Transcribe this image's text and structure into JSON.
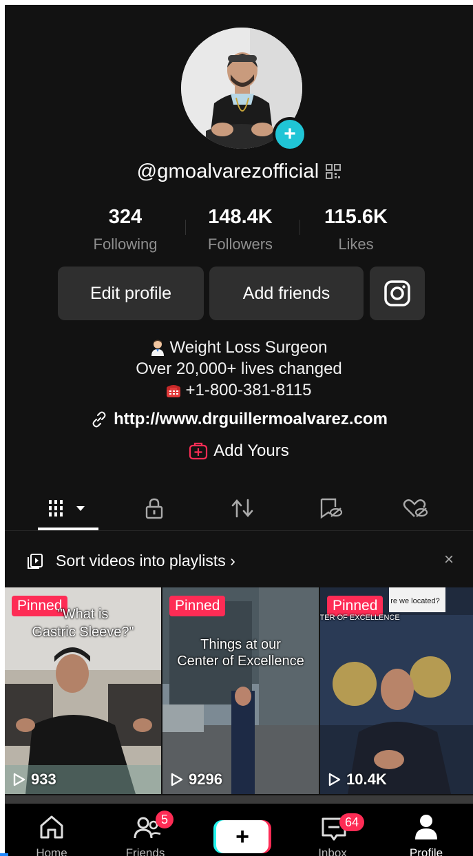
{
  "profile": {
    "username": "@gmoalvarezofficial",
    "stats": [
      {
        "value": "324",
        "label": "Following"
      },
      {
        "value": "148.4K",
        "label": "Followers"
      },
      {
        "value": "115.6K",
        "label": "Likes"
      }
    ]
  },
  "actions": {
    "edit_profile": "Edit profile",
    "add_friends": "Add friends",
    "instagram_icon": "instagram-icon"
  },
  "bio": {
    "line1": "Weight Loss Surgeon",
    "line2": "Over 20,000+ lives changed",
    "line3": "+1-800-381-8115",
    "link": "http://www.drguillermoalvarez.com",
    "add_yours": "Add Yours"
  },
  "tabs": [
    "videos-grid-icon",
    "lock-icon",
    "repost-icon",
    "saved-icon",
    "liked-icon"
  ],
  "playlists_banner": {
    "text": "Sort videos into playlists ›",
    "close": "×"
  },
  "videos": [
    {
      "pinned": "Pinned",
      "caption_line1": "\"What is",
      "caption_line2": "Gastric Sleeve?\"",
      "views": "933"
    },
    {
      "pinned": "Pinned",
      "caption_line1": "Things at our",
      "caption_line2": "Center of Excellence",
      "views": "9296"
    },
    {
      "pinned": "Pinned",
      "caption_line1": "re we located?",
      "caption_line2": "CENTER OF EXCELLENCE",
      "views": "10.4K"
    }
  ],
  "nav": {
    "home": "Home",
    "friends": "Friends",
    "friends_badge": "5",
    "create": "+",
    "inbox": "Inbox",
    "inbox_badge": "64",
    "profile": "Profile"
  },
  "colors": {
    "background": "#121212",
    "accent": "#fe2c55",
    "teal": "#20c5d6",
    "button": "#2f2f2f"
  }
}
